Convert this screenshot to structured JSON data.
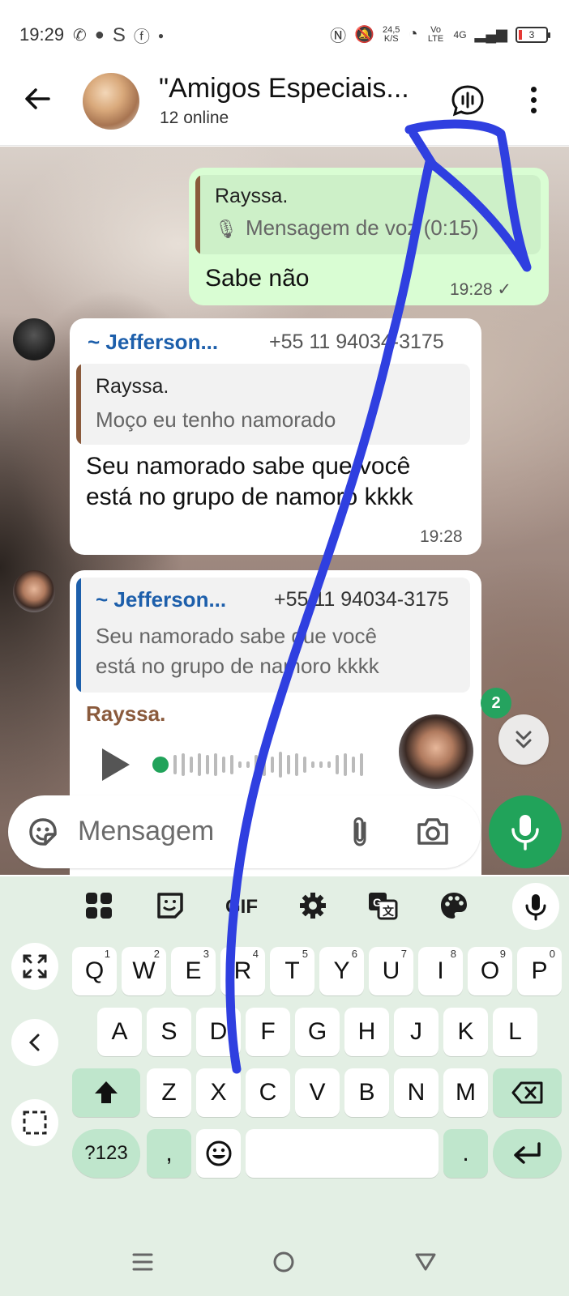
{
  "status_bar": {
    "time": "19:29",
    "net_speed_value": "24,5",
    "net_speed_unit": "K/S",
    "volte": "Vo LTE",
    "network": "4G",
    "battery": "3"
  },
  "header": {
    "title": "\"Amigos Especiais...",
    "subtitle": "12 online"
  },
  "messages": {
    "m1": {
      "quote_name": "Rayssa.",
      "quote_text": "Mensagem de voz (0:15)",
      "text": "Sabe não",
      "time": "19:28"
    },
    "m2": {
      "sender": "~ Jefferson...",
      "phone": "+55 11 94034-3175",
      "quote_name": "Rayssa.",
      "quote_text": "Moço eu tenho namorado",
      "text_line1": "Seu namorado sabe que você",
      "text_line2": "está no grupo de namoro kkkk",
      "time": "19:28"
    },
    "m3": {
      "quote_sender": "~ Jefferson...",
      "quote_phone": "+55 11 94034-3175",
      "quote_line1": "Seu namorado sabe que você",
      "quote_line2": "está no grupo de namoro kkkk",
      "sender": "Rayssa."
    }
  },
  "unread_count": "2",
  "input": {
    "placeholder": "Mensagem"
  },
  "keyboard": {
    "toolbar": {
      "gif": "GIF"
    },
    "row1": [
      {
        "k": "Q",
        "h": "1"
      },
      {
        "k": "W",
        "h": "2"
      },
      {
        "k": "E",
        "h": "3"
      },
      {
        "k": "R",
        "h": "4"
      },
      {
        "k": "T",
        "h": "5"
      },
      {
        "k": "Y",
        "h": "6"
      },
      {
        "k": "U",
        "h": "7"
      },
      {
        "k": "I",
        "h": "8"
      },
      {
        "k": "O",
        "h": "9"
      },
      {
        "k": "P",
        "h": "0"
      }
    ],
    "row2": [
      "A",
      "S",
      "D",
      "F",
      "G",
      "H",
      "J",
      "K",
      "L"
    ],
    "row3": [
      "Z",
      "X",
      "C",
      "V",
      "B",
      "N",
      "M"
    ],
    "symbols_key": "?123",
    "comma_key": ",",
    "period_key": "."
  },
  "colors": {
    "accent_green": "#21a35a",
    "outgoing_bubble": "#d9fdd3",
    "sender_blue": "#1d5fab",
    "rayssa_brown": "#8a5a3c",
    "annotation_blue": "#2f3fe0"
  }
}
